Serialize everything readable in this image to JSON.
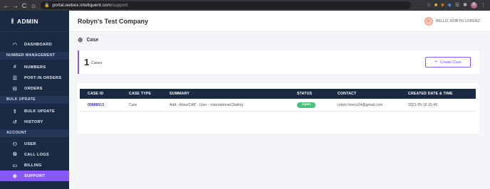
{
  "browser": {
    "back_glyph": "←",
    "forward_glyph": "→",
    "reload_glyph": "C",
    "home_glyph": "⌂",
    "lock_glyph": "🔒",
    "url_host": "portal.webex.inteliquent.com",
    "url_path": "/support",
    "extension_icons": [
      "star-icon",
      "extension-icon",
      "extension-icon",
      "extension-icon",
      "extension-icon",
      "puzzle-icon",
      "profile-avatar",
      "menu-icon"
    ],
    "ext_glyphs": [
      "☆",
      "■",
      "■",
      "◆",
      "☰",
      "✱"
    ],
    "avatar_initial": "R",
    "menu_glyph": "⋮"
  },
  "sidebar": {
    "brand_icon": "sliders-icon",
    "brand_icon_glyph": "⫲",
    "brand": "ADMIN",
    "groups": {
      "number_management": "NUMBER MANAGEMENT",
      "bulk_update": "BULK UPDATE",
      "account": "ACCOUNT"
    },
    "items": {
      "dashboard": {
        "label": "DASHBOARD",
        "icon": "gauge-icon",
        "glyph": "◠"
      },
      "numbers": {
        "label": "NUMBERS",
        "icon": "hash-icon",
        "glyph": "#"
      },
      "port_in_orders": {
        "label": "PORT-IN ORDERS",
        "icon": "list-icon",
        "glyph": "☰"
      },
      "orders": {
        "label": "ORDERS",
        "icon": "document-icon",
        "glyph": "⊟"
      },
      "bulk_update": {
        "label": "BULK UPDATE",
        "icon": "upload-icon",
        "glyph": "⇪"
      },
      "history": {
        "label": "HISTORY",
        "icon": "history-icon",
        "glyph": "↺"
      },
      "user": {
        "label": "USER",
        "icon": "user-icon",
        "glyph": "⚇"
      },
      "call_logs": {
        "label": "CALL LOGS",
        "icon": "call-log-icon",
        "glyph": "⧉"
      },
      "billing": {
        "label": "BILLING",
        "icon": "card-icon",
        "glyph": "▭"
      },
      "support": {
        "label": "SUPPORT",
        "icon": "globe-icon",
        "glyph": "⊕"
      }
    },
    "active_color": "#8a58ff",
    "background_color": "#1b2a43"
  },
  "header": {
    "company": "Robyn's Test Company",
    "user_greeting": "HELLO, ROBYN LORENZ",
    "avatar_icon": "user-avatar",
    "avatar_glyph": "☺"
  },
  "page": {
    "breadcrumb_icon": "globe-icon",
    "breadcrumb_glyph": "⊕",
    "title": "Case"
  },
  "summary": {
    "count": "1",
    "count_label": "Cases",
    "create_glyph": "+",
    "create_label": "Create Case"
  },
  "table": {
    "columns": [
      "CASE ID",
      "CASE TYPE",
      "SUMMARY",
      "STATUS",
      "CONTACT",
      "CREATED DATE & TIME"
    ],
    "rows": [
      {
        "case_id": "00888013",
        "case_type": "Care",
        "summary": "Add - Atlas/CAP - User - International Dialing",
        "status": "Open",
        "contact": "robyn.lorenz24@gmail.com",
        "created": "2021-05-18 15:49"
      }
    ],
    "status_color": "#47c27a"
  }
}
